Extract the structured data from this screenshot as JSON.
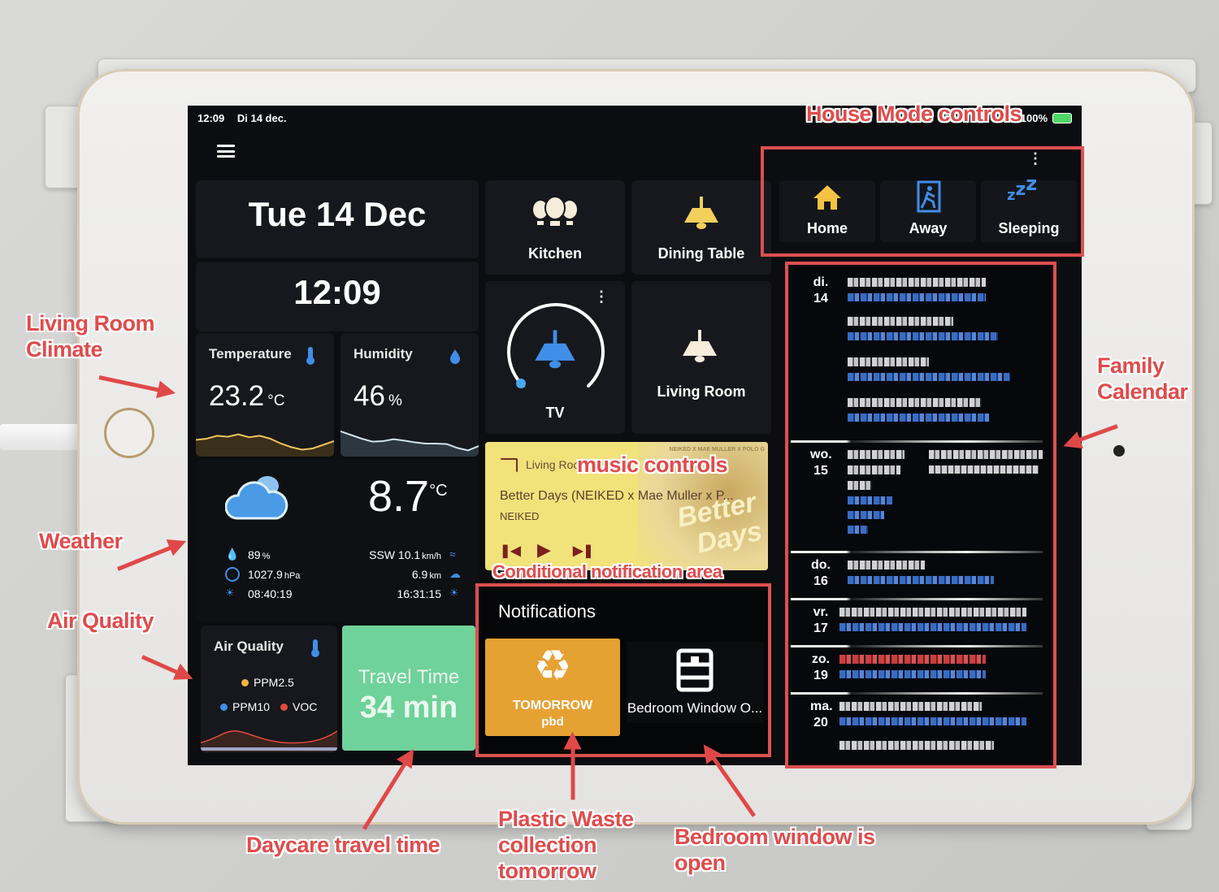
{
  "status_bar": {
    "time": "12:09",
    "date": "Di 14 dec.",
    "battery": "100%"
  },
  "header": {
    "menu_icon": "hamburger-menu-icon"
  },
  "date_card": {
    "date": "Tue 14 Dec",
    "time": "12:09"
  },
  "climate": {
    "temperature": {
      "title": "Temperature",
      "value": "23.2",
      "unit": "°C",
      "icon": "thermometer-icon",
      "history": [
        0.55,
        0.6,
        0.72,
        0.68,
        0.78,
        0.66,
        0.72,
        0.6,
        0.4,
        0.25,
        0.15,
        0.2,
        0.35,
        0.5
      ]
    },
    "humidity": {
      "title": "Humidity",
      "value": "46",
      "unit": "%",
      "icon": "water-percent-icon",
      "history": [
        0.9,
        0.75,
        0.6,
        0.48,
        0.5,
        0.58,
        0.52,
        0.45,
        0.4,
        0.4,
        0.38,
        0.22,
        0.12,
        0.3
      ]
    }
  },
  "lights": [
    {
      "name": "Kitchen",
      "icon": "lightbulb-group-icon",
      "state": "on"
    },
    {
      "name": "Dining Table",
      "icon": "ceiling-light-icon",
      "state": "on"
    },
    {
      "name": "TV",
      "icon": "ceiling-light-icon",
      "state": "on",
      "brightness_pct": 0
    },
    {
      "name": "Living Room",
      "icon": "ceiling-light-icon",
      "state": "on"
    }
  ],
  "house_mode": {
    "modes": [
      {
        "label": "Home",
        "icon": "home-icon",
        "color": "#f5c242"
      },
      {
        "label": "Away",
        "icon": "exit-run-icon",
        "color": "#3f8ee8"
      },
      {
        "label": "Sleeping",
        "icon": "sleep-zzz-icon",
        "color": "#3f8ee8"
      }
    ]
  },
  "weather": {
    "condition_icon": "cloudy-icon",
    "temperature": "8.7",
    "unit": "°C",
    "humidity": "89",
    "humidity_unit": "%",
    "pressure": "1027.9",
    "pressure_unit": "hPa",
    "sunrise": "08:40:19",
    "wind": "SSW 10.1",
    "wind_unit": "km/h",
    "visibility": "6.9",
    "visibility_unit": "km",
    "sunset": "16:31:15"
  },
  "air_quality": {
    "title": "Air Quality",
    "legend": [
      {
        "label": "PPM2.5",
        "color": "#f2b544"
      },
      {
        "label": "PPM10",
        "color": "#3f8ee8"
      },
      {
        "label": "VOC",
        "color": "#e04b3c"
      }
    ]
  },
  "travel_time": {
    "title": "Travel Time",
    "value": "34 min",
    "color": "#6fd29a"
  },
  "media_player": {
    "device": "Living Room",
    "title": "Better Days (NEIKED x Mae Muller x P...",
    "artist": "NEIKED",
    "art_text": "Better Days",
    "art_banner": "NEIKED X MAE MULLER X POLO G"
  },
  "notifications": {
    "title": "Notifications",
    "items": [
      {
        "label": "TOMORROW",
        "sub": "pbd",
        "icon": "recycle-icon",
        "color": "#e6a133"
      },
      {
        "label": "Bedroom Window O...",
        "icon": "window-open-icon"
      }
    ]
  },
  "calendar": {
    "days": [
      {
        "dow": "di.",
        "day": "14"
      },
      {
        "dow": "wo.",
        "day": "15"
      },
      {
        "dow": "do.",
        "day": "16"
      },
      {
        "dow": "vr.",
        "day": "17"
      },
      {
        "dow": "zo.",
        "day": "19"
      },
      {
        "dow": "ma.",
        "day": "20"
      }
    ]
  },
  "annotations": {
    "house_mode": "House Mode controls",
    "climate": "Living Room Climate",
    "weather": "Weather",
    "air_quality": "Air Quality",
    "calendar": "Family Calendar",
    "music": "music controls",
    "conditional": "Conditional notification area",
    "daycare": "Daycare travel time",
    "plastic": "Plastic Waste collection tomorrow",
    "bedroom": "Bedroom window is open"
  }
}
